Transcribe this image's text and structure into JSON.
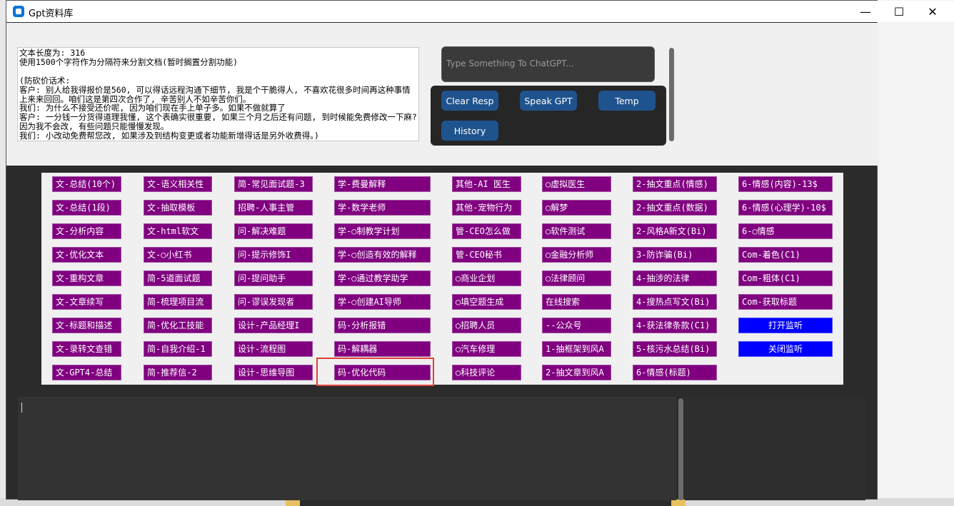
{
  "window": {
    "title": "Gpt资料库",
    "controls": {
      "minimize": "—",
      "maximize": "☐",
      "close": "✕"
    }
  },
  "document": {
    "text": "文本长度为: 316\n使用1500个字符作为分隔符来分割文档(暂时搁置分割功能)\n\n(防砍价话术:\n客户: 别人给我得报价是560, 可以得话远程沟通下细节, 我是个干脆得人, 不喜欢花很多时间再这种事情上来来回回。咱们这是第四次合作了, 辛苦别人不如辛苦你们。\n我们: 为什么不接受还价呢, 因为咱们现在手上单子多。如果不做就算了\n客户: 一分钱一分货得道理我懂, 这个表确实很重要, 如果三个月之后还有问题, 到时候能免费修改一下麻? 因为我不会改, 有些问题只能慢慢发现。\n我们: 小改动免费帮您改, 如果涉及到结构变更或者功能新增得话是另外收费得。)"
  },
  "chat": {
    "placeholder": "Type Something To ChatGPT..."
  },
  "controls": {
    "clear_resp": "Clear Resp",
    "speak_gpt": "Speak GPT",
    "temp": "Temp",
    "history": "History"
  },
  "prompt_columns": [
    [
      "文-总结(10个)",
      "文-总结(1段)",
      "文-分析内容",
      "文-优化文本",
      "文-重构文章",
      "文-文章续写",
      "文-标题和描述",
      "文-录转文查错",
      "文-GPT4-总结"
    ],
    [
      "文-语义相关性",
      "文-抽取模板",
      "文-html软文",
      "文-○小红书",
      "简-5道面试题",
      "简-梳理项目流",
      "简-优化工技能",
      "简-自我介绍-1",
      "简-推荐信-2"
    ],
    [
      "简-常见面试题-3",
      "招聘-人事主管",
      "问-解决难题",
      "问-提示修饰I",
      "问-提问助手",
      "问-谬误发现者",
      "设计-产品经理I",
      "设计-流程图",
      "设计-思维导图"
    ],
    [
      "学-费曼解释",
      "学-数学老师",
      "学-○制教学计划",
      "学-○创造有效的解释",
      "学-○通过教学助学",
      "学-○创建AI导师",
      "码-分析报错",
      "码-解耦器",
      "码-优化代码"
    ],
    [
      "其他-AI 医生",
      "其他-宠物行为",
      "管-CEO怎么做",
      "管-CEO秘书",
      "○商业企划",
      "○填空题生成",
      "○招聘人员",
      "○汽车修理",
      "○科技评论"
    ],
    [
      "○虚拟医生",
      "○解梦",
      "○软件测试",
      "○金融分析师",
      "○法律顾问",
      "在线搜索",
      "--公众号",
      "1-抽框架到风A",
      "2-抽文章到风A"
    ],
    [
      "2-抽文重点(情感)",
      "2-抽文重点(数据)",
      "2-风格A新文(Bi)",
      "3-防诈骗(Bi)",
      "4-抽涉的法律",
      "4-搜热点写文(Bi)",
      "4-获法律条款(C1)",
      "5-核污水总结(Bi)",
      "6-情感(标题)"
    ],
    [
      "6-情感(内容)-13$",
      "6-情感(心理学)-10$",
      "6-○情感",
      "Com-着色(C1)",
      "Com-粗体(C1)",
      "Com-获取标题",
      "打开监听",
      "关闭监听"
    ]
  ],
  "colors": {
    "prompt_button": "#800080",
    "listen_button": "#0000ff",
    "ctk_button": "#1f538d",
    "highlight": "#e0403a"
  }
}
